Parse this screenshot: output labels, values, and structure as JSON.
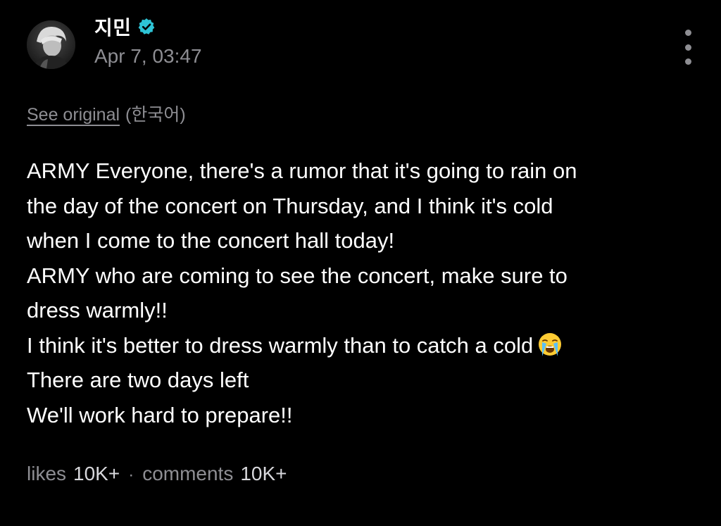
{
  "post": {
    "author": {
      "name": "지민",
      "verified": true,
      "avatar_icon": "avatar-photo"
    },
    "timestamp": "Apr 7, 03:47",
    "translation": {
      "see_original_label": "See original",
      "language_label": "(한국어)"
    },
    "body_lines": [
      "ARMY Everyone, there's a rumor that it's going to rain on",
      "the day of the concert on Thursday, and I think it's cold",
      "when I come to the concert hall today!",
      "ARMY who are coming to see the concert, make sure to",
      "dress warmly!!",
      "I think it's better to dress warmly than to catch a cold",
      "There are two days left",
      "We'll work hard to prepare!!"
    ],
    "emoji": "loudly-crying-face-icon",
    "stats": {
      "likes_label": "likes",
      "likes_value": "10K+",
      "separator": "·",
      "comments_label": "comments",
      "comments_value": "10K+"
    }
  },
  "colors": {
    "background": "#000000",
    "text": "#ffffff",
    "muted": "#8e8e93",
    "verified_badge": "#2ec4d6"
  },
  "icons": {
    "verified": "verified-badge-icon",
    "more": "more-vertical-icon"
  }
}
